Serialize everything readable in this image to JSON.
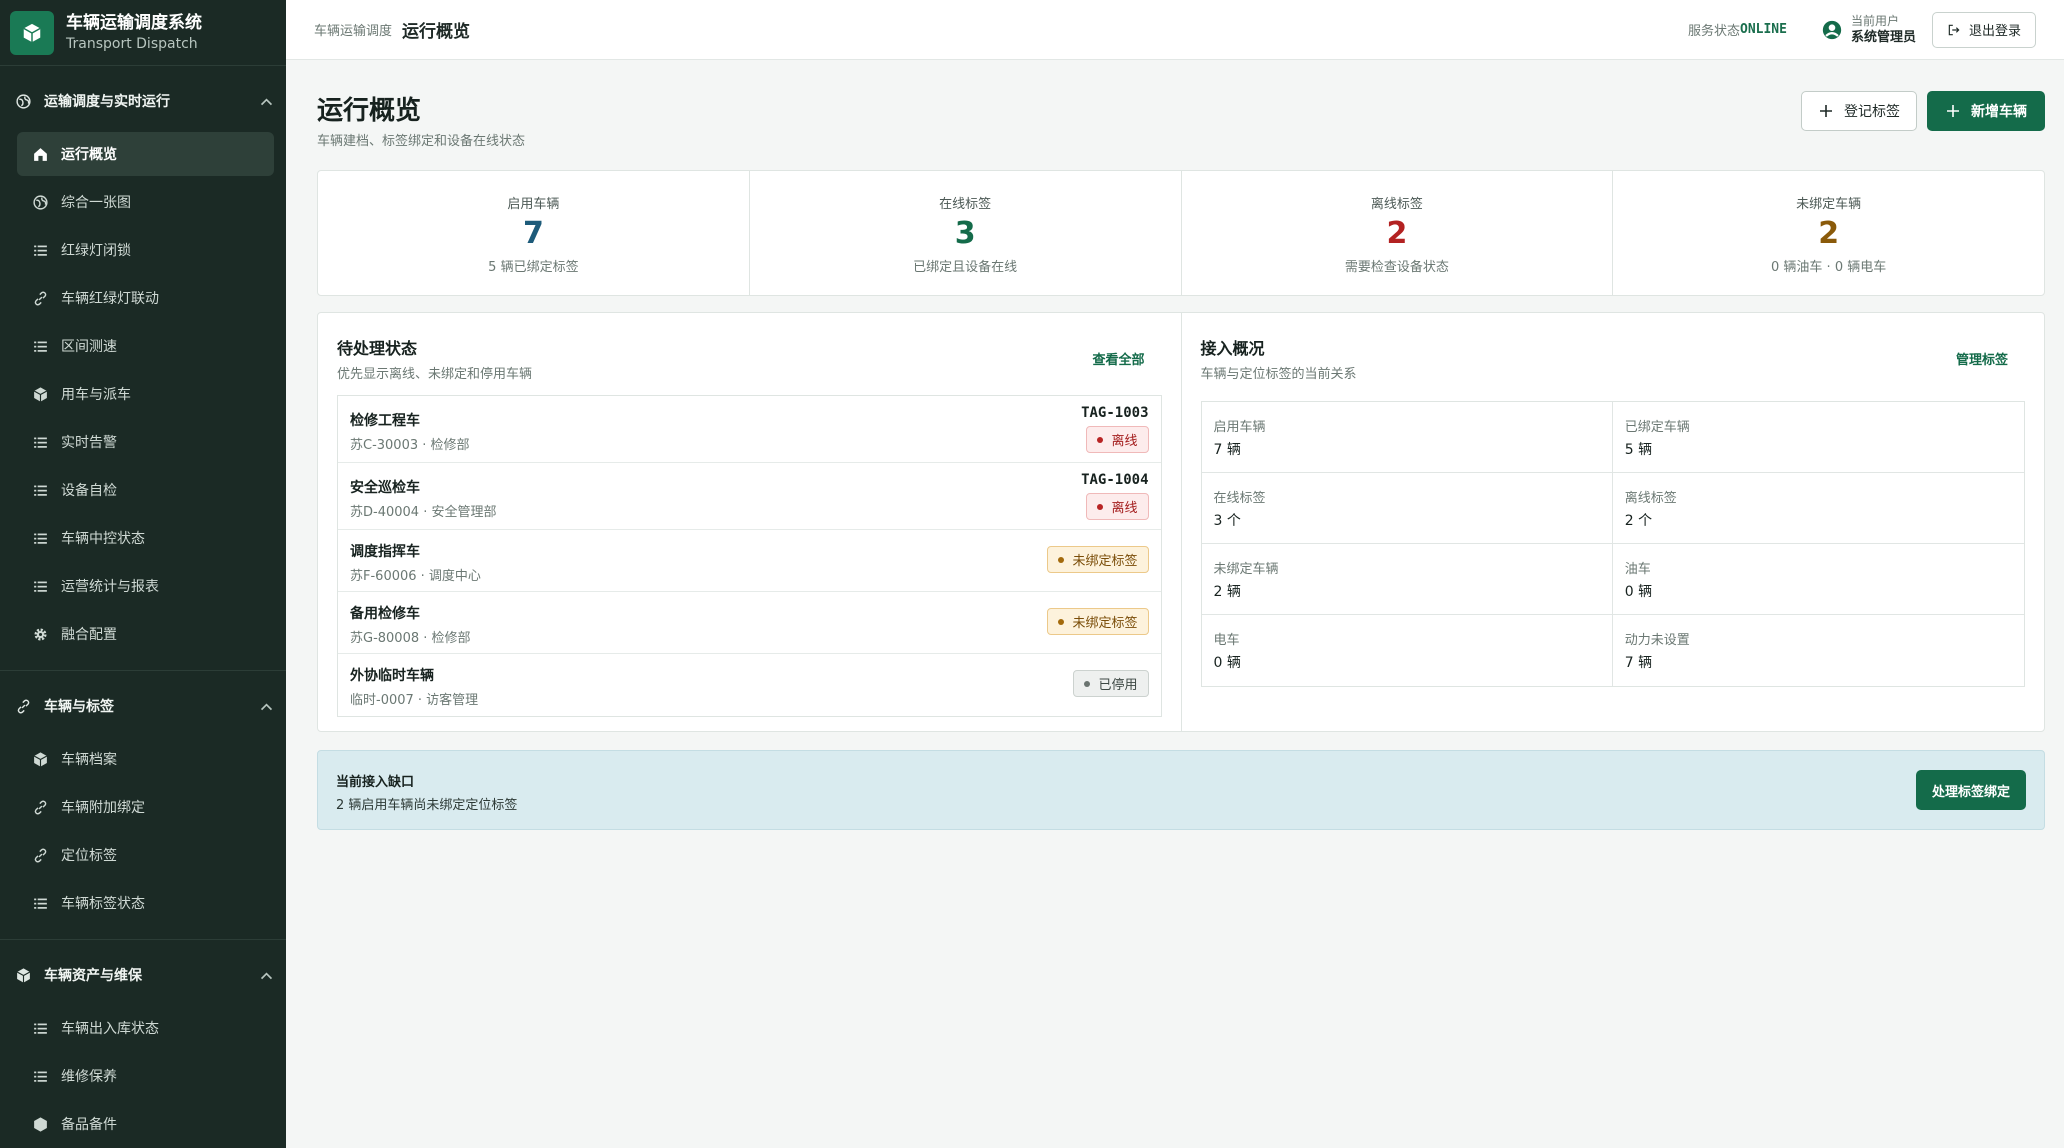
{
  "app": {
    "title": "车辆运输调度系统",
    "subtitle": "Transport Dispatch"
  },
  "sidebar": {
    "groups": [
      {
        "label": "运输调度与实时运行",
        "items": [
          {
            "label": "运行概览",
            "icon": "home-icon"
          },
          {
            "label": "综合一张图",
            "icon": "globe-icon"
          },
          {
            "label": "红绿灯闭锁",
            "icon": "list-icon"
          },
          {
            "label": "车辆红绿灯联动",
            "icon": "link-icon"
          },
          {
            "label": "区间测速",
            "icon": "list-icon"
          },
          {
            "label": "用车与派车",
            "icon": "cube-icon"
          },
          {
            "label": "实时告警",
            "icon": "list-icon"
          },
          {
            "label": "设备自检",
            "icon": "list-icon"
          },
          {
            "label": "车辆中控状态",
            "icon": "list-icon"
          },
          {
            "label": "运营统计与报表",
            "icon": "list-icon"
          },
          {
            "label": "融合配置",
            "icon": "gear-icon"
          }
        ]
      },
      {
        "label": "车辆与标签",
        "items": [
          {
            "label": "车辆档案",
            "icon": "cube-icon"
          },
          {
            "label": "车辆附加绑定",
            "icon": "link-icon"
          },
          {
            "label": "定位标签",
            "icon": "link-icon"
          },
          {
            "label": "车辆标签状态",
            "icon": "list-icon"
          }
        ]
      },
      {
        "label": "车辆资产与维保",
        "items": [
          {
            "label": "车辆出入库状态",
            "icon": "list-icon"
          },
          {
            "label": "维修保养",
            "icon": "list-icon"
          },
          {
            "label": "备品备件",
            "icon": "cube-icon"
          }
        ]
      }
    ]
  },
  "header": {
    "breadcrumb_parent": "车辆运输调度",
    "breadcrumb_current": "运行概览",
    "service_label": "服务状态",
    "service_value": "ONLINE",
    "user_label": "当前用户",
    "user_name": "系统管理员",
    "logout_label": "退出登录"
  },
  "page": {
    "title": "运行概览",
    "subtitle": "车辆建档、标签绑定和设备在线状态",
    "register_tag_label": "登记标签",
    "add_vehicle_label": "新增车辆"
  },
  "stats": [
    {
      "label": "启用车辆",
      "value": "7",
      "note": "5 辆已绑定标签",
      "color": "#1d5b7a"
    },
    {
      "label": "在线标签",
      "value": "3",
      "note": "已绑定且设备在线",
      "color": "#146b4a"
    },
    {
      "label": "离线标签",
      "value": "2",
      "note": "需要检查设备状态",
      "color": "#b32222"
    },
    {
      "label": "未绑定车辆",
      "value": "2",
      "note": "0 辆油车 · 0 辆电车",
      "color": "#8a5a0a"
    }
  ],
  "pending": {
    "title": "待处理状态",
    "subtitle": "优先显示离线、未绑定和停用车辆",
    "link": "查看全部",
    "rows": [
      {
        "name": "检修工程车",
        "meta": "苏C-30003 · 检修部",
        "tag": "TAG-1003",
        "status": "离线"
      },
      {
        "name": "安全巡检车",
        "meta": "苏D-40004 · 安全管理部",
        "tag": "TAG-1004",
        "status": "离线"
      },
      {
        "name": "调度指挥车",
        "meta": "苏F-60006 · 调度中心",
        "status": "未绑定标签"
      },
      {
        "name": "备用检修车",
        "meta": "苏G-80008 · 检修部",
        "status": "未绑定标签"
      },
      {
        "name": "外协临时车辆",
        "meta": "临时-0007 · 访客管理",
        "status": "已停用"
      }
    ]
  },
  "access": {
    "title": "接入概况",
    "subtitle": "车辆与定位标签的当前关系",
    "link": "管理标签",
    "cells": [
      {
        "label": "启用车辆",
        "value": "7 辆"
      },
      {
        "label": "已绑定车辆",
        "value": "5 辆"
      },
      {
        "label": "在线标签",
        "value": "3 个"
      },
      {
        "label": "离线标签",
        "value": "2 个"
      },
      {
        "label": "未绑定车辆",
        "value": "2 辆"
      },
      {
        "label": "油车",
        "value": "0 辆"
      },
      {
        "label": "电车",
        "value": "0 辆"
      },
      {
        "label": "动力未设置",
        "value": "7 辆"
      }
    ]
  },
  "gap": {
    "title": "当前接入缺口",
    "text": "2 辆启用车辆尚未绑定定位标签",
    "button": "处理标签绑定"
  }
}
